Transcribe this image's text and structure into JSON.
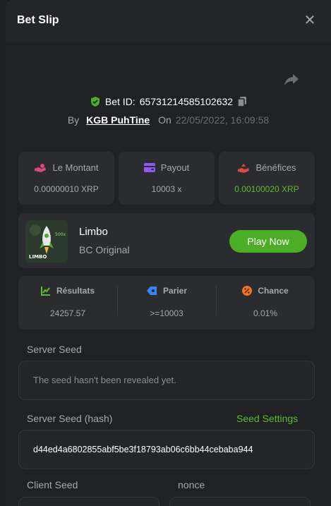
{
  "modal": {
    "title": "Bet Slip",
    "close_icon": "close-icon"
  },
  "bet": {
    "id_label": "Bet ID:",
    "id": "65731214585102632",
    "by_label": "By",
    "user": "KGB PuhTine",
    "on_label": "On",
    "datetime": "22/05/2022, 16:09:58"
  },
  "stats": [
    {
      "label": "Le Montant",
      "value": "0.00000010 XRP",
      "icon": "coin-hand-icon",
      "color": "#e0457b"
    },
    {
      "label": "Payout",
      "value": "10003 x",
      "icon": "wallet-icon",
      "color": "#8b5cf6"
    },
    {
      "label": "Bénéfices",
      "value": "0.00100020 XRP",
      "icon": "profit-hand-icon",
      "color": "#e04848"
    }
  ],
  "game": {
    "name": "Limbo",
    "subtitle": "BC Original",
    "play_label": "Play Now",
    "thumb_badge": "500x",
    "thumb_text": "LIMBO"
  },
  "results": [
    {
      "label": "Résultats",
      "value": "24257.57",
      "icon": "chart-icon",
      "color": "#5bbd2a"
    },
    {
      "label": "Parier",
      "value": ">=10003",
      "icon": "tag-icon",
      "color": "#3b82f6"
    },
    {
      "label": "Chance",
      "value": "0.01%",
      "icon": "percent-icon",
      "color": "#f97316"
    }
  ],
  "seeds": {
    "server_seed_label": "Server Seed",
    "server_seed_value": "The seed hasn't been revealed yet.",
    "server_hash_label": "Server Seed (hash)",
    "seed_settings_label": "Seed Settings",
    "server_hash_value": "d44ed4a6802855abf5be3f18793ab06c6bb44cebaba944",
    "client_seed_label": "Client Seed",
    "nonce_label": "nonce"
  },
  "colors": {
    "accent_green": "#4cae24",
    "positive_text": "#5bbd2a"
  }
}
